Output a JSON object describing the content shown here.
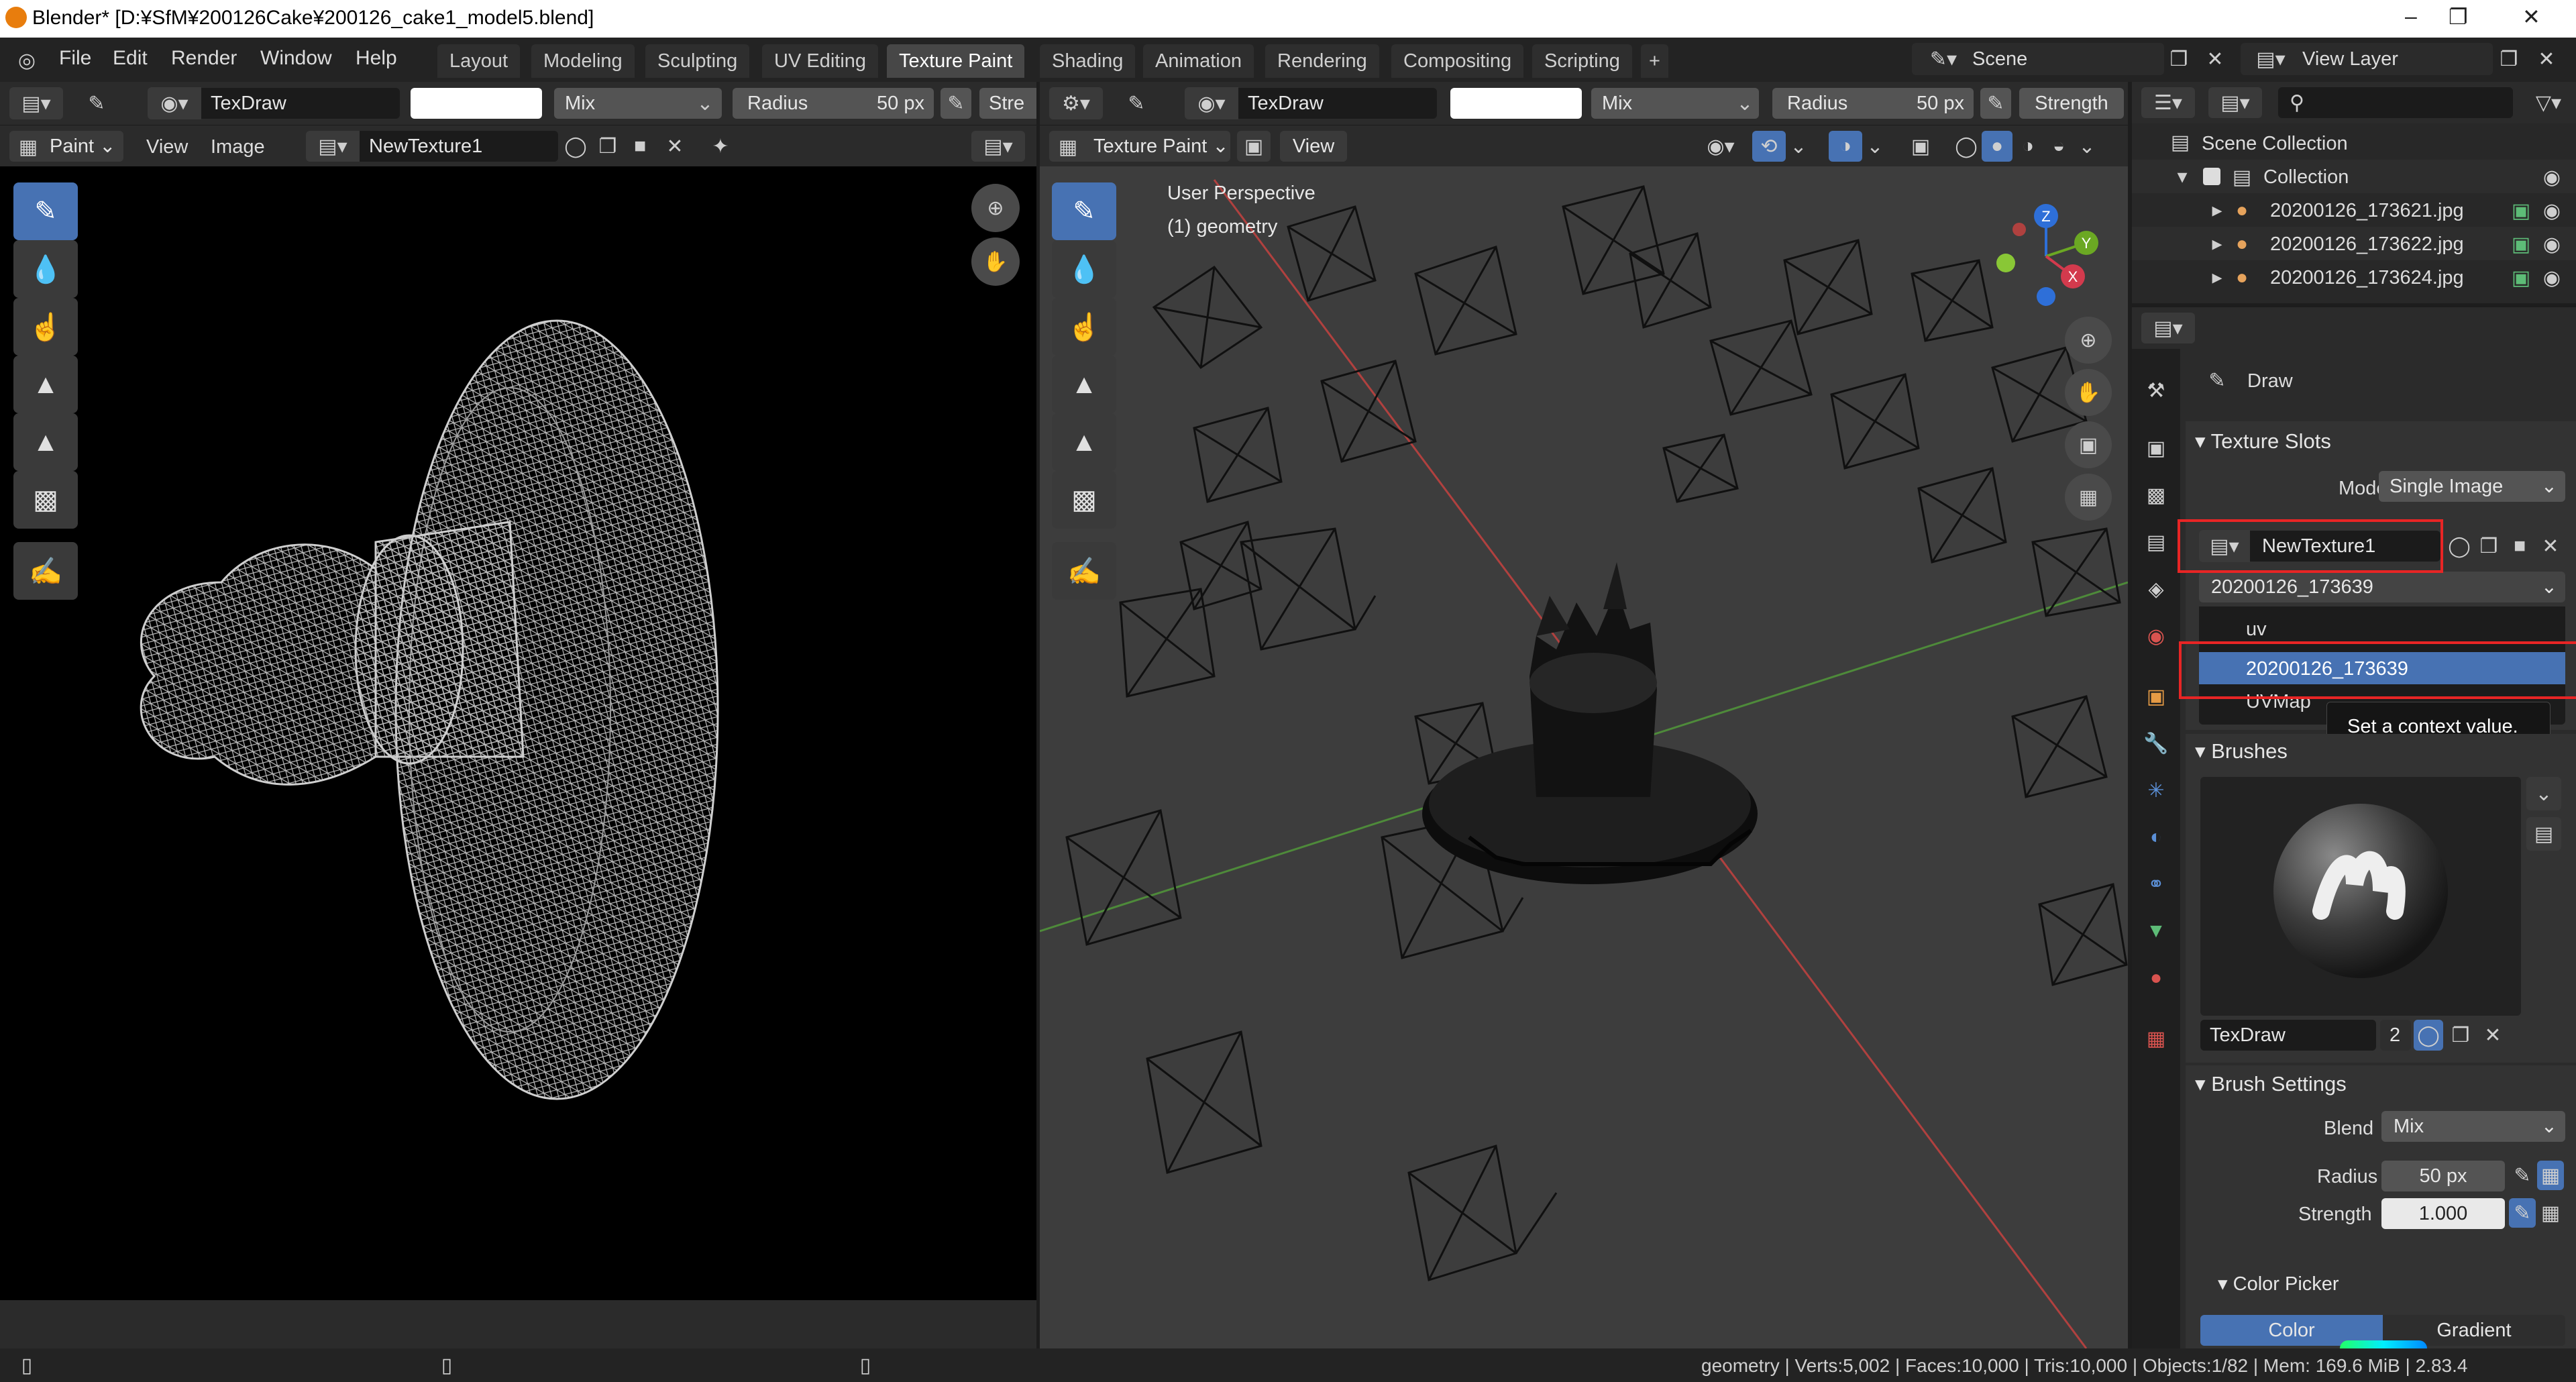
{
  "window": {
    "title": "Blender* [D:¥SfM¥200126Cake¥200126_cake1_model5.blend]",
    "minimize": "–",
    "maximize": "❐",
    "close": "✕"
  },
  "menu": [
    "File",
    "Edit",
    "Render",
    "Window",
    "Help"
  ],
  "workspaces": [
    "Layout",
    "Modeling",
    "Sculpting",
    "UV Editing",
    "Texture Paint",
    "Shading",
    "Animation",
    "Rendering",
    "Compositing",
    "Scripting"
  ],
  "active_workspace": "Texture Paint",
  "scene": {
    "label": "Scene",
    "view_layer": "View Layer"
  },
  "image_editor": {
    "brush_name": "TexDraw",
    "blend": "Mix",
    "radius_label": "Radius",
    "radius_value": "50 px",
    "strength_label": "Stre",
    "mode": "Paint",
    "menu": [
      "View",
      "Image"
    ],
    "image_name": "NewTexture1"
  },
  "viewport": {
    "brush_name": "TexDraw",
    "blend": "Mix",
    "radius_label": "Radius",
    "radius_value": "50 px",
    "strength_label": "Strength",
    "mode": "Texture Paint",
    "view_menu": "View",
    "overlay_line1": "User Perspective",
    "overlay_line2": "(1) geometry",
    "gizmo": {
      "z": "Z",
      "y": "Y",
      "x": "X"
    }
  },
  "outliner": {
    "root": "Scene Collection",
    "collection": "Collection",
    "items": [
      "20200126_173621.jpg",
      "20200126_173622.jpg",
      "20200126_173624.jpg"
    ]
  },
  "properties": {
    "tool_name": "Draw",
    "texture_slots": {
      "header": "Texture Slots",
      "mode_label": "Mode",
      "mode_value": "Single Image",
      "image_name": "NewTexture1",
      "uv_dropdown": "20200126_173639",
      "options": [
        "uv",
        "20200126_173639",
        "UVMap"
      ],
      "selected_option": "20200126_173639",
      "tooltip": "Set a context value."
    },
    "brushes": {
      "header": "Brushes",
      "brush_name": "TexDraw",
      "users": "2"
    },
    "brush_settings": {
      "header": "Brush Settings",
      "blend_label": "Blend",
      "blend_value": "Mix",
      "radius_label": "Radius",
      "radius_value": "50 px",
      "strength_label": "Strength",
      "strength_value": "1.000"
    },
    "color_picker": {
      "header": "Color Picker",
      "tabs": [
        "Color",
        "Gradient"
      ]
    }
  },
  "statusbar": "geometry | Verts:5,002 | Faces:10,000 | Tris:10,000 | Objects:1/82 | Mem: 169.6 MiB | 2.83.4",
  "colors": {
    "accent": "#4772b3",
    "highlight_box": "#e82525",
    "viewport_bg": "#3d3d3d"
  }
}
